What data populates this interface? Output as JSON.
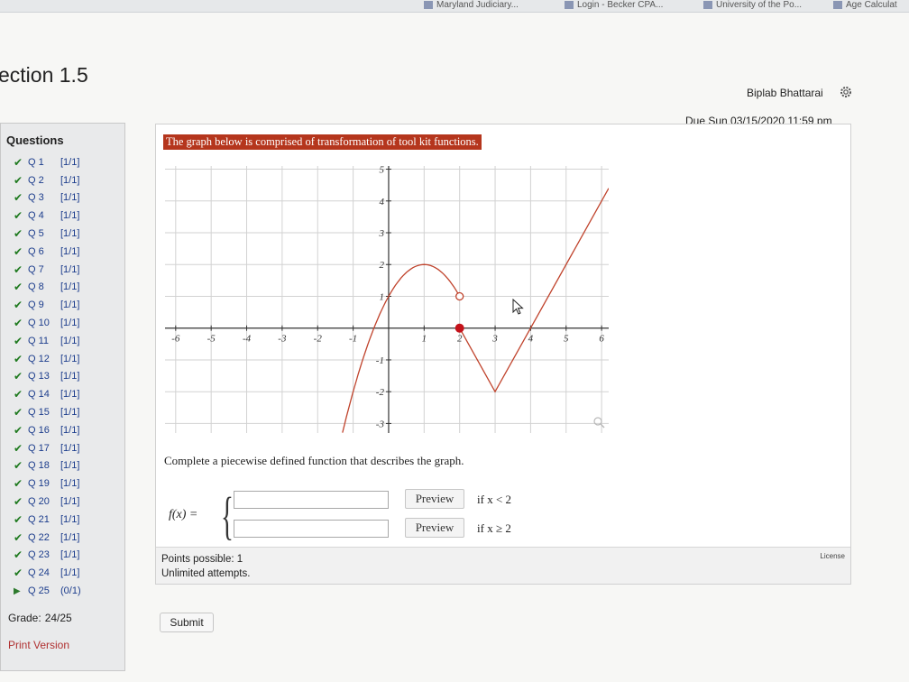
{
  "bookmarks": [
    {
      "label": "Maryland Judiciary..."
    },
    {
      "label": "Login - Becker CPA..."
    },
    {
      "label": "University of the Po..."
    },
    {
      "label": "Age Calculat"
    }
  ],
  "page": {
    "section_title": "ection 1.5",
    "user_name": "Biplab Bhattarai",
    "due_date": "Due Sun 03/15/2020 11:59 pm"
  },
  "sidebar": {
    "heading": "Questions",
    "questions": [
      {
        "label": "Q 1",
        "score": "[1/1]",
        "status": "done"
      },
      {
        "label": "Q 2",
        "score": "[1/1]",
        "status": "done"
      },
      {
        "label": "Q 3",
        "score": "[1/1]",
        "status": "done"
      },
      {
        "label": "Q 4",
        "score": "[1/1]",
        "status": "done"
      },
      {
        "label": "Q 5",
        "score": "[1/1]",
        "status": "done"
      },
      {
        "label": "Q 6",
        "score": "[1/1]",
        "status": "done"
      },
      {
        "label": "Q 7",
        "score": "[1/1]",
        "status": "done"
      },
      {
        "label": "Q 8",
        "score": "[1/1]",
        "status": "done"
      },
      {
        "label": "Q 9",
        "score": "[1/1]",
        "status": "done"
      },
      {
        "label": "Q 10",
        "score": "[1/1]",
        "status": "done"
      },
      {
        "label": "Q 11",
        "score": "[1/1]",
        "status": "done"
      },
      {
        "label": "Q 12",
        "score": "[1/1]",
        "status": "done"
      },
      {
        "label": "Q 13",
        "score": "[1/1]",
        "status": "done"
      },
      {
        "label": "Q 14",
        "score": "[1/1]",
        "status": "done"
      },
      {
        "label": "Q 15",
        "score": "[1/1]",
        "status": "done"
      },
      {
        "label": "Q 16",
        "score": "[1/1]",
        "status": "done"
      },
      {
        "label": "Q 17",
        "score": "[1/1]",
        "status": "done"
      },
      {
        "label": "Q 18",
        "score": "[1/1]",
        "status": "done"
      },
      {
        "label": "Q 19",
        "score": "[1/1]",
        "status": "done"
      },
      {
        "label": "Q 20",
        "score": "[1/1]",
        "status": "done"
      },
      {
        "label": "Q 21",
        "score": "[1/1]",
        "status": "done"
      },
      {
        "label": "Q 22",
        "score": "[1/1]",
        "status": "done"
      },
      {
        "label": "Q 23",
        "score": "[1/1]",
        "status": "done"
      },
      {
        "label": "Q 24",
        "score": "[1/1]",
        "status": "done"
      },
      {
        "label": "Q 25",
        "score": "(0/1)",
        "status": "current"
      }
    ],
    "grade_label": "Grade:",
    "grade_value": "24/25",
    "print_label": "Print Version"
  },
  "question": {
    "header": "The graph below is comprised of transformation of tool kit functions.",
    "instructions": "Complete a piecewise defined function that describes the graph.",
    "fx_label": "f(x) =",
    "rows": [
      {
        "value": "",
        "preview_label": "Preview",
        "condition": "if x < 2"
      },
      {
        "value": "",
        "preview_label": "Preview",
        "condition": "if x ≥ 2"
      }
    ],
    "license_label": "License",
    "points_possible": "Points possible: 1",
    "attempts": "Unlimited attempts.",
    "submit_label": "Submit"
  },
  "graph": {
    "x_ticks": [
      "-6",
      "-5",
      "-4",
      "-3",
      "-2",
      "-1",
      "1",
      "2",
      "3",
      "4",
      "5",
      "6"
    ],
    "y_ticks": [
      "-3",
      "-2",
      "-1",
      "1",
      "2",
      "3",
      "4",
      "5"
    ],
    "x_range": [
      -6.3,
      6.2
    ],
    "y_range": [
      -3.3,
      5.1
    ],
    "curve_color": "#c0432c",
    "point_color": "#c4121a",
    "left_piece": {
      "type": "parabola",
      "vertex": [
        1,
        2
      ],
      "a": -1,
      "domain": [
        -1.3,
        2
      ],
      "endpoint": [
        2,
        1
      ],
      "endpoint_open": true
    },
    "right_piece": {
      "type": "absolute-value",
      "vertex": [
        3,
        -2
      ],
      "points": [
        [
          2,
          0
        ],
        [
          3,
          -2
        ],
        [
          6.2,
          4.4
        ]
      ],
      "endpoint": [
        2,
        0
      ],
      "endpoint_open": false
    }
  },
  "colors": {
    "accent": "#b5361d",
    "link": "#1b3c8c",
    "check": "#1f7a1f",
    "print": "#b03030"
  }
}
